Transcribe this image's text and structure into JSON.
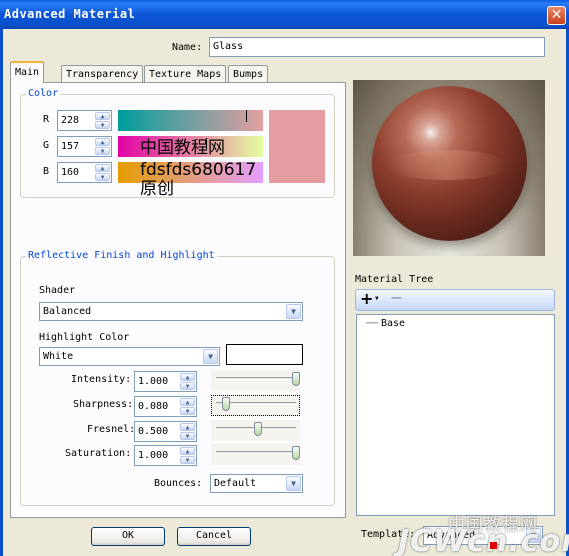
{
  "window": {
    "title": "Advanced Material",
    "close_glyph": "✕"
  },
  "name_row": {
    "label": "Name:",
    "value": "Glass"
  },
  "tabs": [
    {
      "label": "Main",
      "selected": true
    },
    {
      "label": "Transparency",
      "selected": false
    },
    {
      "label": "Texture Maps",
      "selected": false
    },
    {
      "label": "Bumps",
      "selected": false
    }
  ],
  "color_group": {
    "title": "Color",
    "r": {
      "label": "R",
      "value": "228"
    },
    "g": {
      "label": "G",
      "value": "157"
    },
    "b": {
      "label": "B",
      "value": "160"
    },
    "swatch_color": "#e49da0",
    "watermark_lines": [
      "中国教程网",
      "fdsfds680617",
      "原创"
    ]
  },
  "reflective": {
    "title": "Reflective Finish and Highlight",
    "shader_label": "Shader",
    "shader_value": "Balanced",
    "highlight_label": "Highlight Color",
    "highlight_value": "White",
    "highlight_swatch_color": "#ffffff",
    "intensity": {
      "label": "Intensity:",
      "value": "1.000",
      "level": 1.0
    },
    "sharpness": {
      "label": "Sharpness:",
      "value": "0.080",
      "level": 0.08
    },
    "fresnel": {
      "label": "Fresnel:",
      "value": "0.500",
      "level": 0.5
    },
    "saturation": {
      "label": "Saturation:",
      "value": "1.000",
      "level": 1.0
    },
    "bounces_label": "Bounces:",
    "bounces_value": "Default"
  },
  "material_tree": {
    "label": "Material Tree",
    "add_glyph": "+",
    "add_arrow": "▼",
    "remove_glyph": "−",
    "items": [
      {
        "label": "Base",
        "connector": "⋯⋯"
      }
    ]
  },
  "buttons": {
    "ok": "OK",
    "cancel": "Cancel"
  },
  "template": {
    "label": "Template:",
    "value": "Advanced"
  },
  "site_watermark": {
    "line1": "中国教程网",
    "line2": "JCWcn.com"
  },
  "icons": {
    "spin_up": "▲",
    "spin_down": "▼",
    "dropdown_arrow": "▼"
  }
}
